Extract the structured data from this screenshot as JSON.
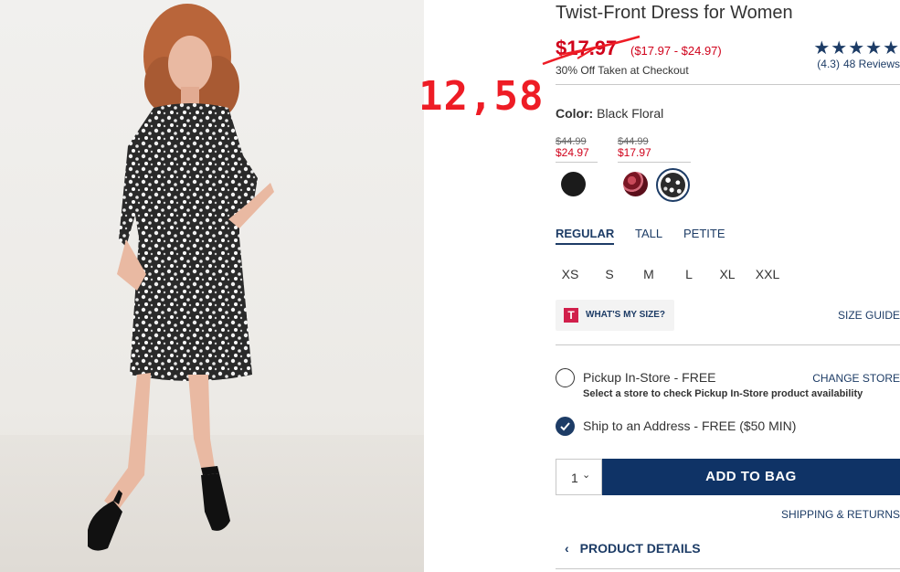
{
  "overlay": {
    "number": "12,58",
    "color": "#ee1c25"
  },
  "product": {
    "title": "Twist-Front Dress for Women",
    "sale_price": "$17.97",
    "price_range": "($17.97 - $24.97)",
    "discount_note": "30% Off Taken at Checkout",
    "stars": "★★★★★",
    "rating": 4.3,
    "rating_text": "(4.3)",
    "reviews": "48 Reviews"
  },
  "color": {
    "label": "Color:",
    "value": "Black Floral",
    "groups": [
      {
        "old_price": "$44.99",
        "new_price": "$24.97"
      },
      {
        "old_price": "$44.99",
        "new_price": "$17.97"
      }
    ],
    "swatches": [
      "Black",
      "Red Floral",
      "Black Floral"
    ],
    "selected": "Black Floral"
  },
  "fits": {
    "tabs": [
      "REGULAR",
      "TALL",
      "PETITE"
    ],
    "active": "REGULAR"
  },
  "sizes": [
    "XS",
    "S",
    "M",
    "L",
    "XL",
    "XXL"
  ],
  "size_help": {
    "badge": "T",
    "label": "WHAT'S MY SIZE?",
    "guide": "SIZE GUIDE"
  },
  "shipping": {
    "pickup_label": "Pickup In-Store - FREE",
    "pickup_sub": "Select a store to check Pickup In-Store product availability",
    "change_store": "CHANGE STORE",
    "ship_label": "Ship to an Address - FREE ($50 MIN)",
    "selected": "ship"
  },
  "cart": {
    "qty": "1",
    "add_label": "ADD TO BAG",
    "ship_returns": "SHIPPING & RETURNS",
    "button_color": "#0f3366"
  },
  "details": {
    "label": "PRODUCT DETAILS"
  },
  "colors": {
    "brand_navy": "#1d3c66",
    "sale_red": "#d0021b"
  }
}
